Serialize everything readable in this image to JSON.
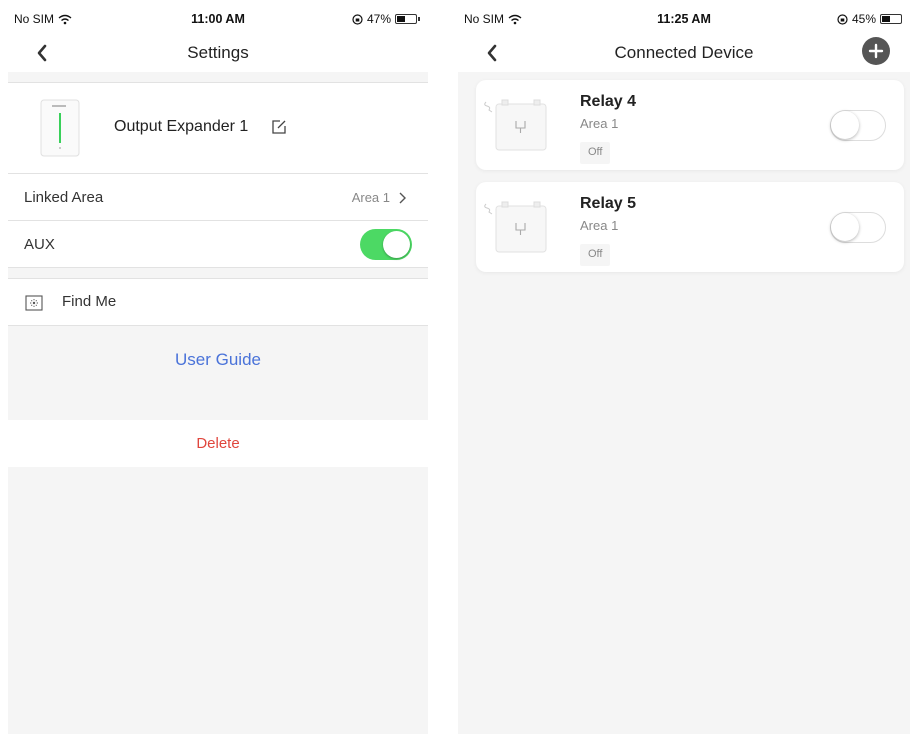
{
  "colors": {
    "accent_link": "#4a73d9",
    "danger": "#e0463d",
    "toggle_on": "#4cd964"
  },
  "left_screen": {
    "status": {
      "carrier": "No SIM",
      "time": "11:00 AM",
      "battery": "47%",
      "battery_level": 0.47
    },
    "nav": {
      "title": "Settings",
      "back_icon": "chevron-left-icon"
    },
    "device": {
      "name": "Output Expander 1",
      "edit_icon": "edit-icon"
    },
    "linked_area": {
      "label": "Linked Area",
      "value": "Area 1"
    },
    "aux": {
      "label": "AUX",
      "enabled": true
    },
    "find_me": {
      "label": "Find Me",
      "icon": "find-me-icon"
    },
    "user_guide": "User Guide",
    "delete": "Delete"
  },
  "right_screen": {
    "status": {
      "carrier": "No SIM",
      "time": "11:25 AM",
      "battery": "45%",
      "battery_level": 0.45
    },
    "nav": {
      "title": "Connected Device",
      "back_icon": "chevron-left-icon",
      "add_icon": "plus-icon"
    },
    "devices": [
      {
        "name": "Relay 4",
        "area": "Area 1",
        "state": "Off",
        "enabled": false
      },
      {
        "name": "Relay 5",
        "area": "Area 1",
        "state": "Off",
        "enabled": false
      }
    ]
  }
}
